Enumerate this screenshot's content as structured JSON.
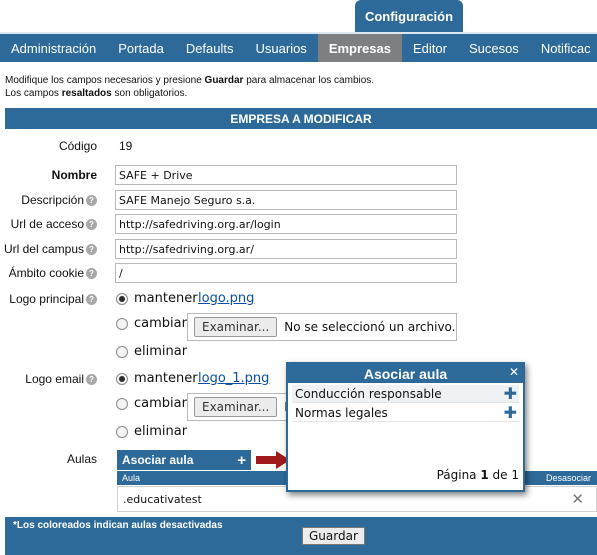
{
  "top_tab": "Configuración",
  "nav": {
    "items": [
      "Administración",
      "Portada",
      "Defaults",
      "Usuarios",
      "Empresas",
      "Editor",
      "Sucesos",
      "Notificac"
    ],
    "active_index": 4
  },
  "instructions": {
    "line1_prefix": "Modifique los campos necesarios y presione ",
    "line1_bold": "Guardar",
    "line1_suffix": " para almacenar los cambios.",
    "line2_prefix": "Los campos ",
    "line2_bold": "resaltados",
    "line2_suffix": " son obligatorios."
  },
  "section_title": "EMPRESA A MODIFICAR",
  "form": {
    "codigo_label": "Código",
    "codigo_value": "19",
    "nombre_label": "Nombre",
    "nombre_value": "SAFE + Drive",
    "descripcion_label": "Descripción",
    "descripcion_value": "SAFE Manejo Seguro s.a.",
    "url_acceso_label": "Url de acceso",
    "url_acceso_value": "http://safedriving.org.ar/login",
    "url_campus_label": "Url del campus",
    "url_campus_value": "http://safedriving.org.ar/",
    "ambito_label": "Ámbito cookie",
    "ambito_value": "/",
    "logo_principal_label": "Logo principal",
    "logo_email_label": "Logo email",
    "mantener_label": "mantener",
    "cambiar_label": "cambiar",
    "eliminar_label": "eliminar",
    "logo_principal_file": "logo.png",
    "logo_email_file": "logo_1.png",
    "examinar_label": "Examinar...",
    "no_file_text": "No se seleccionó un archivo.",
    "aulas_label": "Aulas"
  },
  "aulas": {
    "header": "Asociar aula",
    "col_aula": "Aula",
    "col_desasociar": "Desasociar",
    "rows": [
      ".educativatest"
    ]
  },
  "popup": {
    "title": "Asociar aula",
    "items": [
      "Conducción responsable",
      "Normas legales"
    ],
    "pager_prefix": "Página ",
    "page": "1",
    "pager_mid": " de ",
    "total": "1"
  },
  "footer": {
    "note": "*Los coloreados indican aulas desactivadas",
    "save_label": "Guardar"
  },
  "colors": {
    "primary": "#2d6a99",
    "active_tab": "#7d7f81",
    "arrow": "#a01a1a",
    "link": "#0b4ea2"
  }
}
